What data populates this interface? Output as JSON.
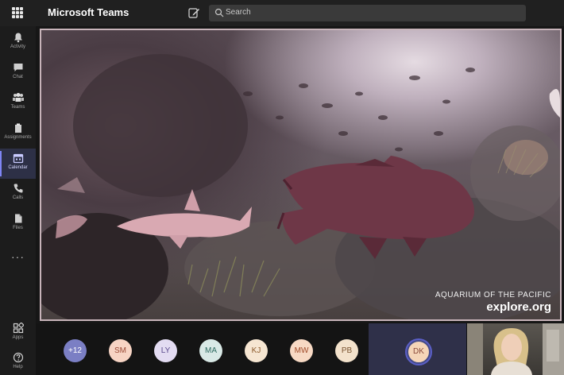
{
  "app": {
    "title": "Microsoft Teams"
  },
  "search": {
    "placeholder": "Search"
  },
  "rail": {
    "items": [
      {
        "label": "Activity",
        "icon": "bell-icon"
      },
      {
        "label": "Chat",
        "icon": "chat-icon"
      },
      {
        "label": "Teams",
        "icon": "teams-icon"
      },
      {
        "label": "Assignments",
        "icon": "assignments-icon"
      },
      {
        "label": "Calendar",
        "icon": "calendar-icon",
        "active": true
      },
      {
        "label": "Calls",
        "icon": "phone-icon"
      },
      {
        "label": "Files",
        "icon": "file-icon"
      }
    ],
    "more": "···",
    "bottom": [
      {
        "label": "Apps",
        "icon": "apps-icon"
      },
      {
        "label": "Help",
        "icon": "help-icon"
      }
    ]
  },
  "video": {
    "caption_line1": "AQUARIUM OF THE PACIFIC",
    "caption_line2": "explore.org"
  },
  "participants": {
    "overflow": "+12",
    "items": [
      {
        "initials": "SM",
        "bg": "#f7d4c4",
        "fg": "#9a4a36"
      },
      {
        "initials": "LY",
        "bg": "#e3dcf2",
        "fg": "#5b4a8c"
      },
      {
        "initials": "MA",
        "bg": "#d9e9e6",
        "fg": "#2f6b61"
      },
      {
        "initials": "KJ",
        "bg": "#f6e6d2",
        "fg": "#8b5a2b"
      },
      {
        "initials": "MW",
        "bg": "#f7d9c4",
        "fg": "#a04b2a"
      },
      {
        "initials": "PB",
        "bg": "#f3e2cc",
        "fg": "#7a5330"
      }
    ],
    "active": {
      "initials": "DK"
    }
  },
  "colors": {
    "accent": "#5b5fc7",
    "overflow_bg": "#7b7fc4"
  }
}
